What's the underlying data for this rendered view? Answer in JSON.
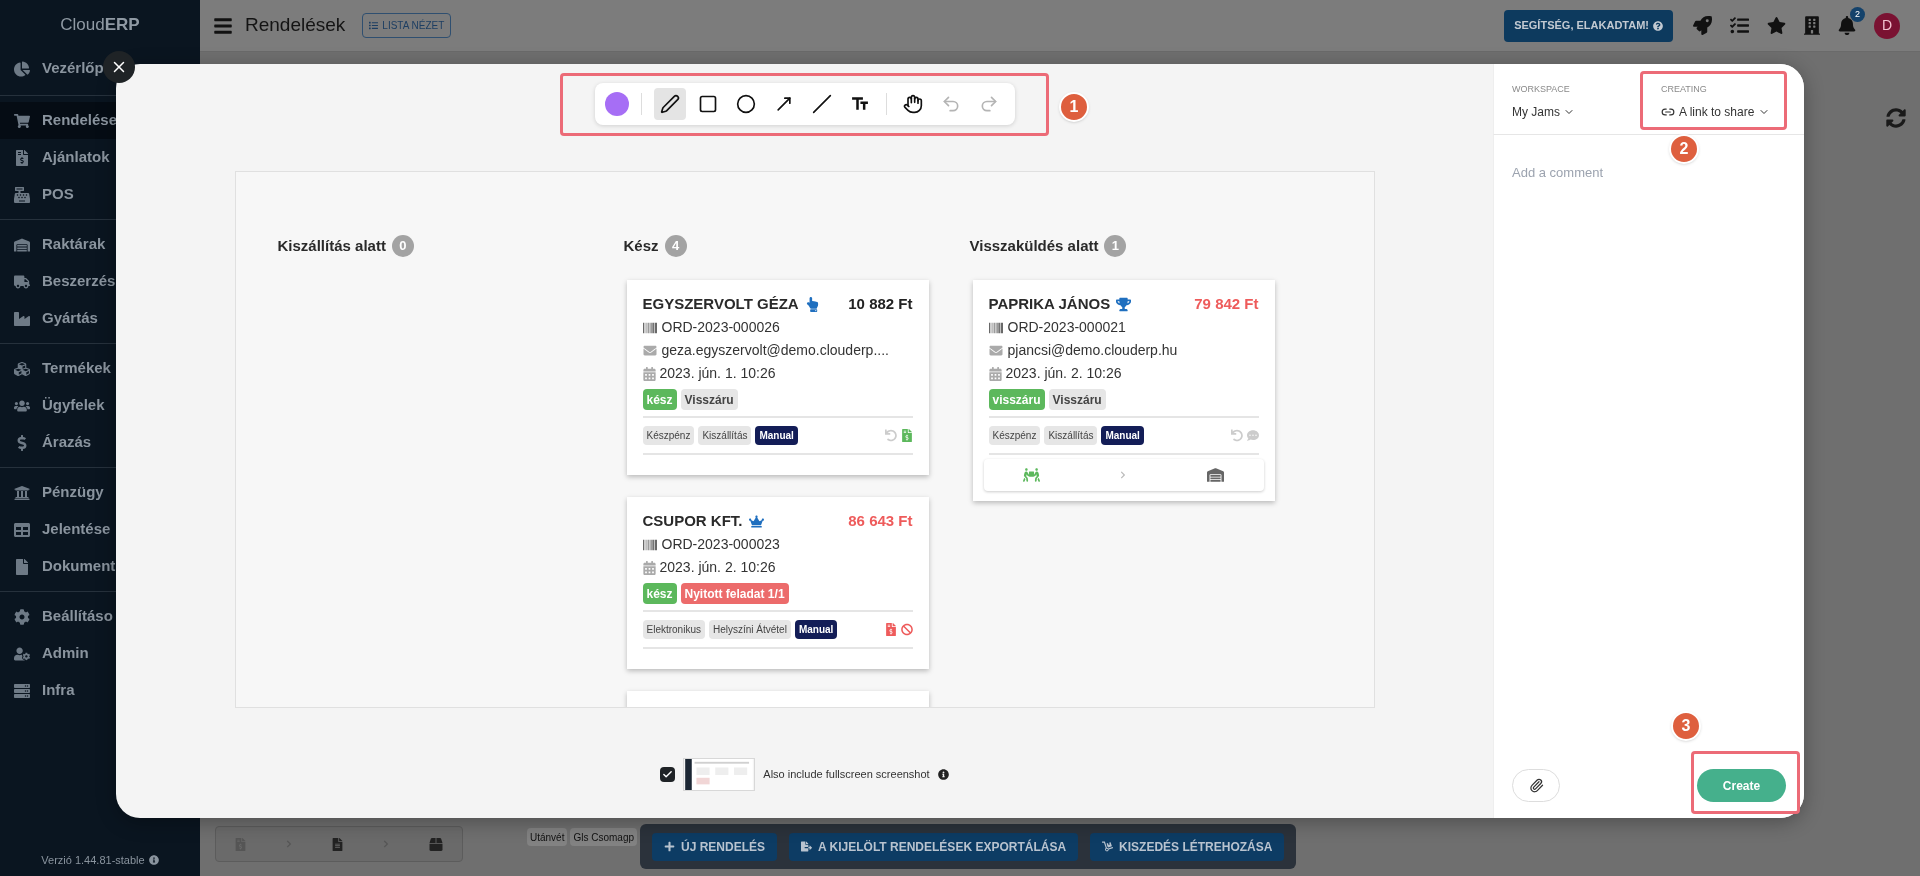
{
  "sidebar": {
    "logo": "Cloud**ERP**",
    "groups": [
      [
        {
          "label": "Vezérlőp",
          "kind": "chart-pie",
          "selected": false
        }
      ],
      [
        {
          "label": "Rendelése",
          "kind": "cart",
          "selected": true
        },
        {
          "label": "Ajánlatok",
          "kind": "invoice",
          "selected": false
        },
        {
          "label": "POS",
          "kind": "register",
          "selected": false
        }
      ],
      [
        {
          "label": "Raktárak",
          "kind": "warehouse",
          "selected": false
        },
        {
          "label": "Beszerzés",
          "kind": "truck",
          "selected": false
        },
        {
          "label": "Gyártás",
          "kind": "industry",
          "selected": false
        }
      ],
      [
        {
          "label": "Termékek",
          "kind": "boxes",
          "selected": false
        },
        {
          "label": "Ügyfelek",
          "kind": "users",
          "selected": false
        },
        {
          "label": "Árazás",
          "kind": "dollar",
          "selected": false
        }
      ],
      [
        {
          "label": "Pénzügy",
          "kind": "bank",
          "selected": false
        },
        {
          "label": "Jelentése",
          "kind": "table",
          "selected": false
        },
        {
          "label": "Dokument",
          "kind": "file",
          "selected": false
        }
      ],
      [
        {
          "label": "Beállításo",
          "kind": "cog",
          "selected": false
        },
        {
          "label": "Admin",
          "kind": "user-cog",
          "selected": false
        },
        {
          "label": "Infra",
          "kind": "server",
          "selected": false
        }
      ]
    ],
    "version": "Verzió 1.44.81-stable"
  },
  "topbar": {
    "title": "Rendelések",
    "view_button": "LISTA NÉZET",
    "help_button": "SEGÍTSÉG, ELAKADTAM!",
    "notification_count": "2",
    "avatar": "D"
  },
  "background": {
    "tags": [
      "Utánvét",
      "Gls Csomagp"
    ],
    "action_buttons": [
      {
        "label": "ÚJ RENDELÉS",
        "kind": "plus"
      },
      {
        "label": "A KIJELÖLT RENDELÉSEK EXPORTÁLÁSA",
        "kind": "export"
      },
      {
        "label": "KISZEDÉS LÉTREHOZÁSA",
        "kind": "dolly"
      }
    ]
  },
  "modal": {
    "toolbar": {
      "color": "#a66ef5",
      "tools": [
        {
          "kind": "pen",
          "selected": true,
          "disabled": false
        },
        {
          "kind": "rectangle",
          "selected": false,
          "disabled": false
        },
        {
          "kind": "ellipse",
          "selected": false,
          "disabled": false
        },
        {
          "kind": "arrow",
          "selected": false,
          "disabled": false
        },
        {
          "kind": "line",
          "selected": false,
          "disabled": false
        },
        {
          "kind": "text",
          "selected": false,
          "disabled": false
        },
        {
          "kind": "hand",
          "selected": false,
          "disabled": false,
          "separator_before": true
        },
        {
          "kind": "undo",
          "selected": false,
          "disabled": true
        },
        {
          "kind": "redo",
          "selected": false,
          "disabled": true
        }
      ]
    },
    "screenshot": {
      "columns": [
        {
          "title": "Kiszállítás alatt",
          "count": "0"
        },
        {
          "title": "Kész",
          "count": "4",
          "cards": [
            {
              "kind": "order",
              "name": "EGYSZERVOLT GÉZA",
              "badge": {
                "kind": "hand"
              },
              "amount": "10 882 Ft",
              "color": "#222222",
              "order_id": "ORD-2023-000026",
              "email": "geza.egyszervolt@demo.clouderp....",
              "date": "2023. jún. 1. 10:26",
              "status_tags": [
                {
                  "label": "kész",
                  "color": "#5cb85c"
                },
                {
                  "label": "Visszáru",
                  "color": "#e6e6e6"
                }
              ],
              "tags": [
                {
                  "label": "Készpénz",
                  "kind": "plain"
                },
                {
                  "label": "Kiszállítás",
                  "kind": "plain"
                },
                {
                  "label": "Manual",
                  "kind": "dark"
                }
              ],
              "status_icons": [
                {
                  "kind": "undo",
                  "color": "#cccccc"
                },
                {
                  "kind": "invoice",
                  "color": "#5cb85c"
                }
              ]
            },
            {
              "kind": "order",
              "name": "CSUPOR KFT.",
              "badge": {
                "kind": "crown"
              },
              "amount": "86 643 Ft",
              "color": "#ee5b5b",
              "order_id": "ORD-2023-000023",
              "date": "2023. jún. 2. 10:26",
              "status_tags": [
                {
                  "label": "kész",
                  "color": "#5cb85c"
                },
                {
                  "label": "Nyitott feladat 1/1",
                  "color": "#ec6b6b"
                }
              ],
              "tags": [
                {
                  "label": "Elektronikus",
                  "kind": "plain"
                },
                {
                  "label": "Helyszíni Átvétel",
                  "kind": "plain"
                },
                {
                  "label": "Manual",
                  "kind": "dark"
                }
              ],
              "status_icons": [
                {
                  "kind": "invoice",
                  "color": "#ee5b5b"
                },
                {
                  "kind": "ban",
                  "color": "#ee5b5b"
                }
              ]
            },
            {
              "kind": "cut"
            }
          ]
        },
        {
          "title": "Visszaküldés alatt",
          "count": "1",
          "cards": [
            {
              "kind": "order",
              "name": "PAPRIKA JÁNOS",
              "badge": {
                "kind": "trophy"
              },
              "amount": "79 842 Ft",
              "color": "#ee5b5b",
              "order_id": "ORD-2023-000021",
              "email": "pjancsi@demo.clouderp.hu",
              "date": "2023. jún. 2. 10:26",
              "status_tags": [
                {
                  "label": "visszáru",
                  "color": "#5cb85c"
                },
                {
                  "label": "Visszáru",
                  "color": "#e6e6e6"
                }
              ],
              "tags": [
                {
                  "label": "Készpénz",
                  "kind": "plain"
                },
                {
                  "label": "Kiszállítás",
                  "kind": "plain"
                },
                {
                  "label": "Manual",
                  "kind": "dark"
                }
              ],
              "status_icons": [
                {
                  "kind": "undo",
                  "color": "#cccccc"
                },
                {
                  "kind": "comment",
                  "color": "#cccccc"
                }
              ],
              "steps": [
                {
                  "kind": "people",
                  "color": "#5cb85c"
                },
                {
                  "kind": "garage",
                  "color": "#666666"
                }
              ]
            }
          ]
        }
      ]
    },
    "checkbox": {
      "label": "Also include fullscreen screenshot",
      "checked": true
    },
    "side_panel": {
      "workspace_label": "WORKSPACE",
      "workspace": "My Jams",
      "creating_label": "CREATING",
      "creating": "A link to share",
      "comment_placeholder": "Add a comment",
      "create_button": "Create"
    }
  },
  "annotations": [
    {
      "number": "1"
    },
    {
      "number": "2"
    },
    {
      "number": "3"
    }
  ]
}
